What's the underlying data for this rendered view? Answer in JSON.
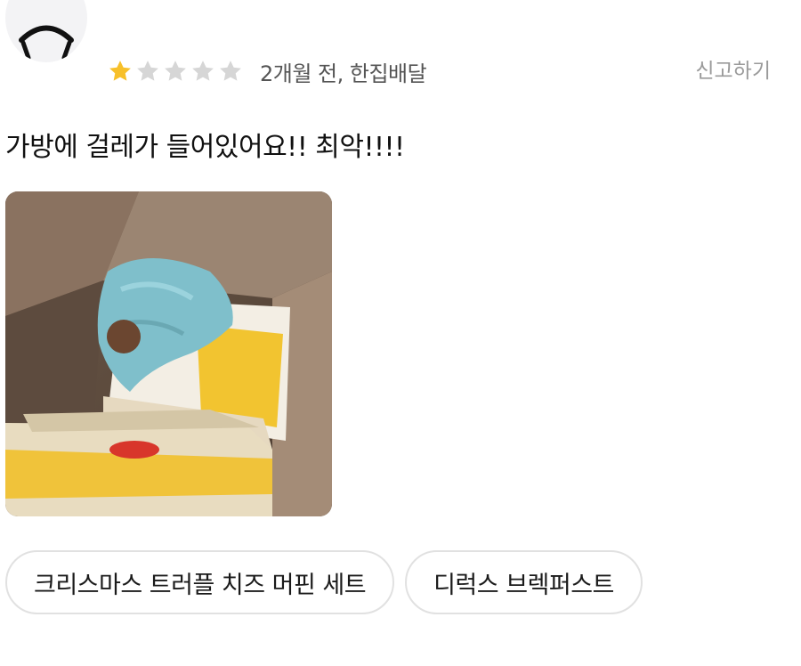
{
  "review": {
    "rating": 1,
    "max_rating": 5,
    "meta": "2개월 전, 한집배달",
    "report_label": "신고하기",
    "text": "가방에 걸레가 들어있어요!! 최악!!!!",
    "photo_icon": "review-photo"
  },
  "menu_chips": [
    {
      "label": "크리스마스 트러플 치즈 머핀 세트"
    },
    {
      "label": "디럭스 브렉퍼스트"
    }
  ],
  "colors": {
    "star_filled": "#f7c02a",
    "star_empty": "#d6d6d6",
    "meta_text": "#555555",
    "report_text": "#9a9a9a",
    "chip_border": "#e1e1e1"
  }
}
